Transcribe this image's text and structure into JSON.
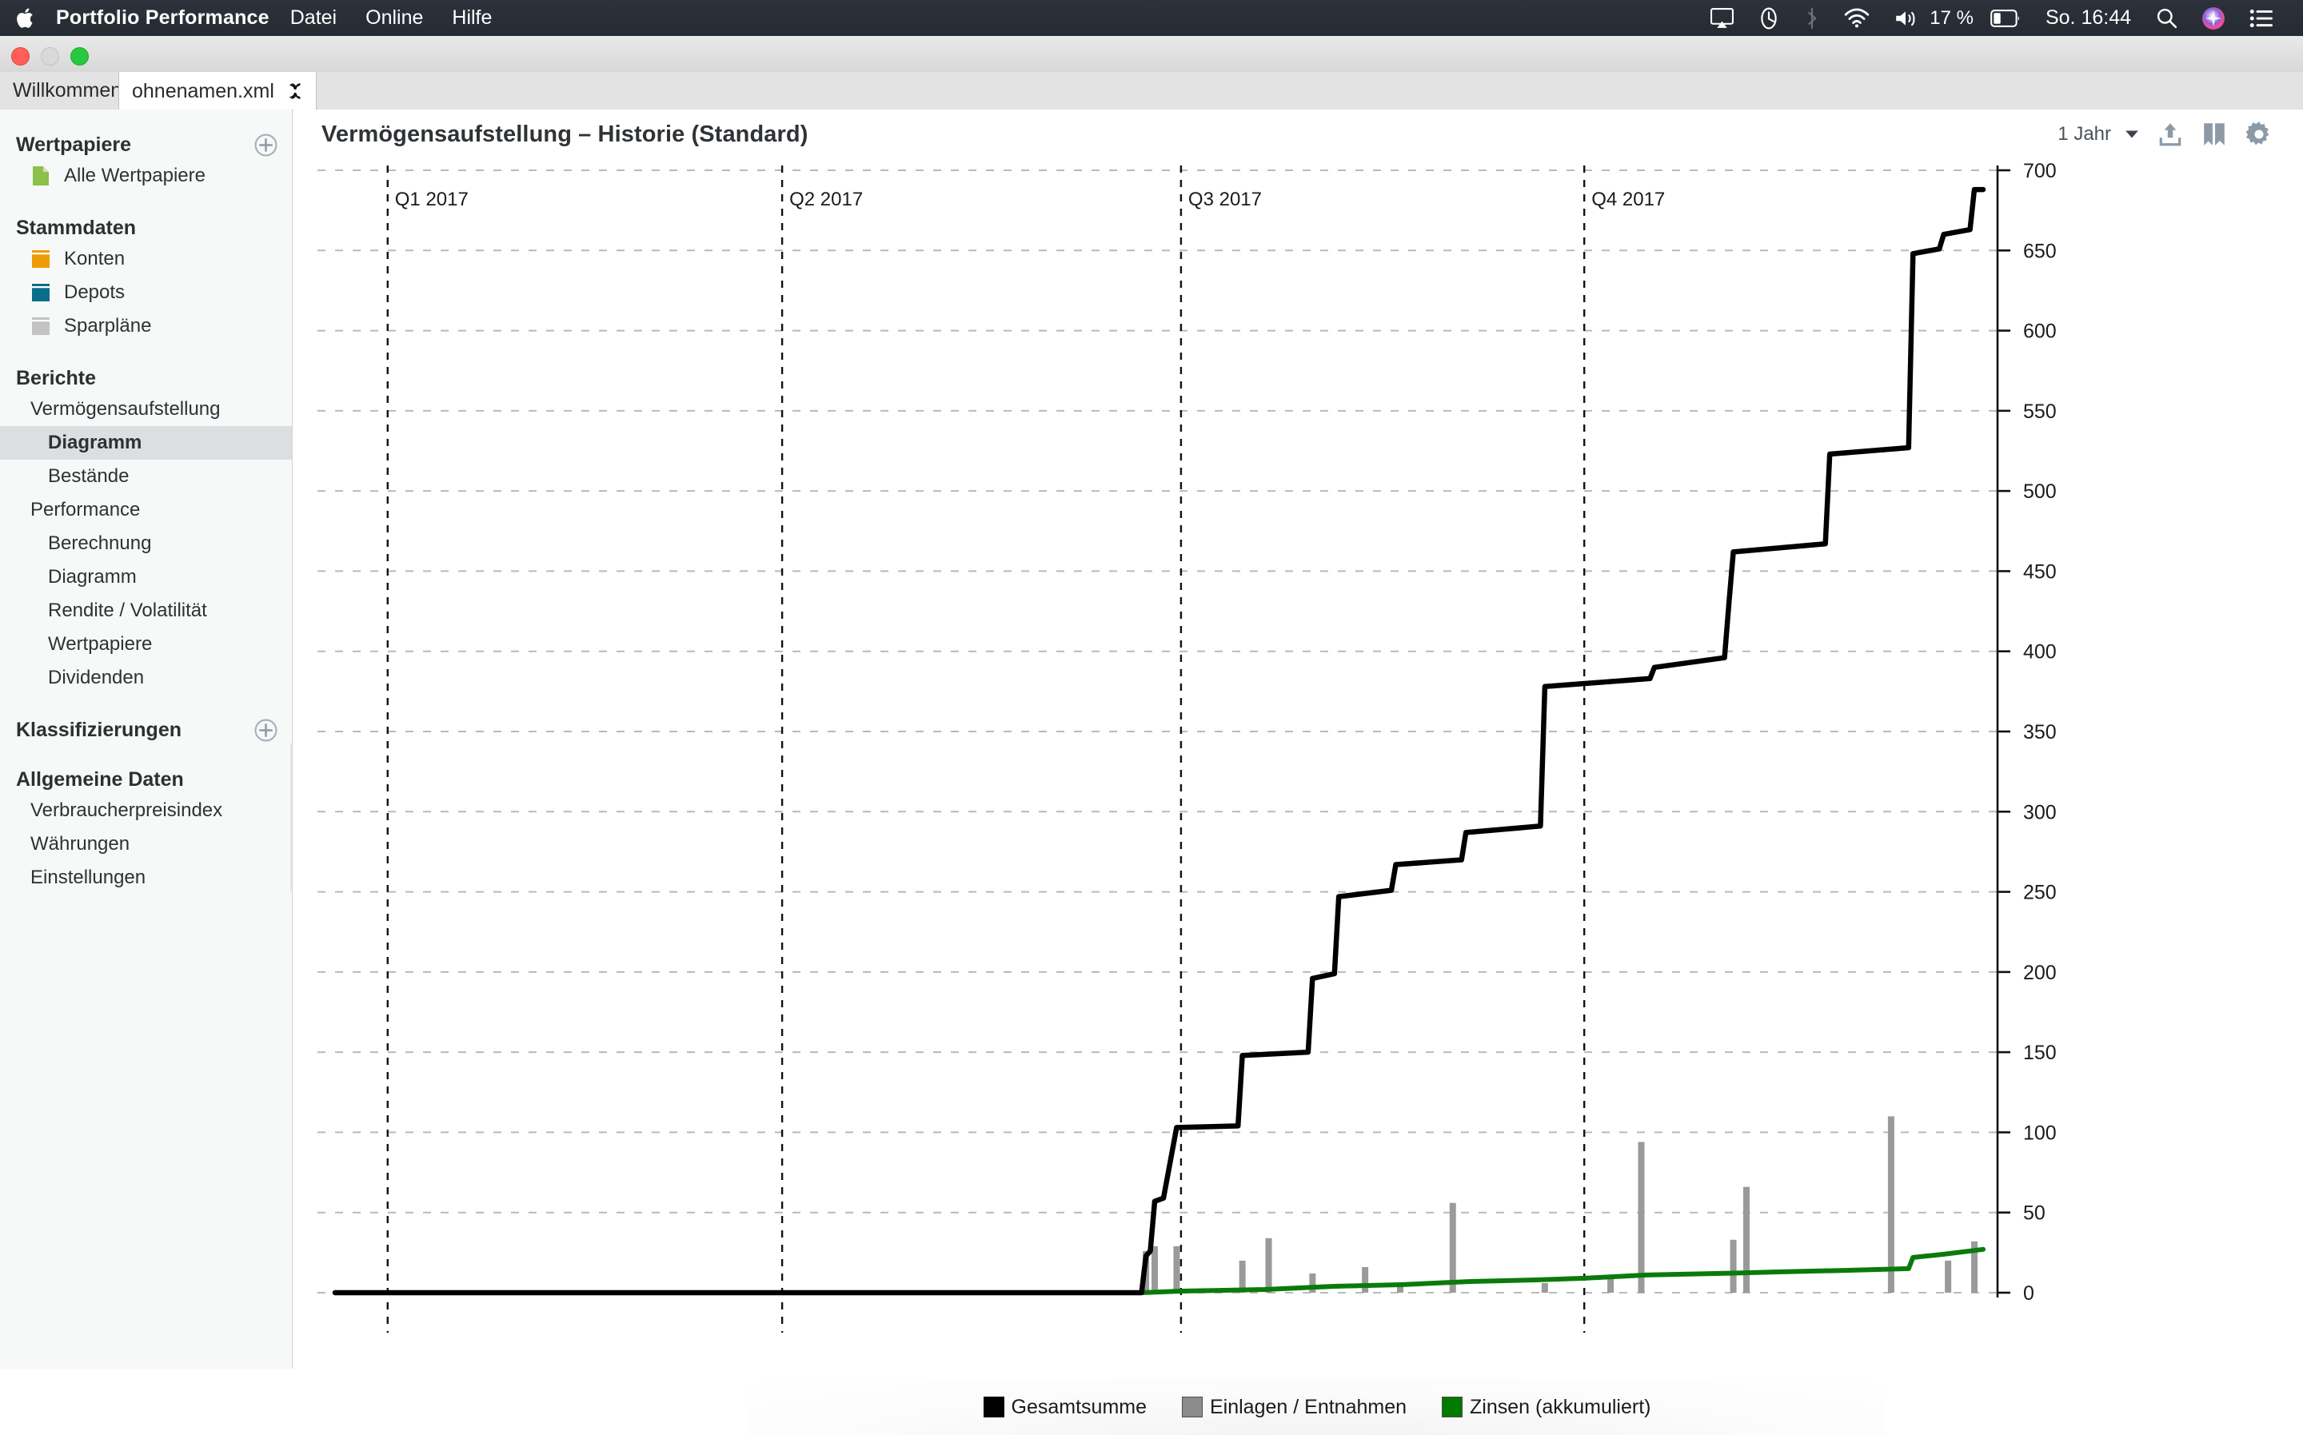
{
  "menubar": {
    "app_name": "Portfolio Performance",
    "menus": [
      "Datei",
      "Online",
      "Hilfe"
    ],
    "status": {
      "battery_percent": "17 %",
      "clock": "So. 16:44",
      "icons": [
        "airplay-icon",
        "time-machine-icon",
        "bluetooth-icon",
        "wifi-icon",
        "volume-icon",
        "battery-icon",
        "spotlight-search-icon",
        "siri-icon",
        "control-center-icon"
      ]
    }
  },
  "window": {
    "traffic_lights": [
      "close-button",
      "minimize-button",
      "zoom-button"
    ],
    "tabs": [
      {
        "label": "Willkommen",
        "active": false,
        "closable": false
      },
      {
        "label": "ohnenamen.xml",
        "active": true,
        "closable": true
      }
    ]
  },
  "sidebar": {
    "sections": [
      {
        "title": "Wertpapiere",
        "has_add": true,
        "items": [
          {
            "label": "Alle Wertpapiere",
            "icon": "document-icon",
            "color": "#8cc04a",
            "level": 1,
            "selected": false
          }
        ]
      },
      {
        "title": "Stammdaten",
        "has_add": false,
        "items": [
          {
            "label": "Konten",
            "icon": "book-icon",
            "color": "#ef9a08",
            "level": 1,
            "selected": false
          },
          {
            "label": "Depots",
            "icon": "book-icon",
            "color": "#0a6e8a",
            "level": 1,
            "selected": false
          },
          {
            "label": "Sparpläne",
            "icon": "book-icon",
            "color": "#c3c3c3",
            "level": 1,
            "selected": false
          }
        ]
      },
      {
        "title": "Berichte",
        "has_add": false,
        "items": [
          {
            "label": "Vermögensaufstellung",
            "icon": null,
            "color": null,
            "level": 1,
            "selected": false
          },
          {
            "label": "Diagramm",
            "icon": null,
            "color": null,
            "level": 2,
            "selected": true
          },
          {
            "label": "Bestände",
            "icon": null,
            "color": null,
            "level": 2,
            "selected": false
          },
          {
            "label": "Performance",
            "icon": null,
            "color": null,
            "level": 1,
            "selected": false
          },
          {
            "label": "Berechnung",
            "icon": null,
            "color": null,
            "level": 2,
            "selected": false
          },
          {
            "label": "Diagramm",
            "icon": null,
            "color": null,
            "level": 2,
            "selected": false
          },
          {
            "label": "Rendite / Volatilität",
            "icon": null,
            "color": null,
            "level": 2,
            "selected": false
          },
          {
            "label": "Wertpapiere",
            "icon": null,
            "color": null,
            "level": 2,
            "selected": false
          },
          {
            "label": "Dividenden",
            "icon": null,
            "color": null,
            "level": 2,
            "selected": false
          }
        ]
      },
      {
        "title": "Klassifizierungen",
        "has_add": true,
        "items": []
      },
      {
        "title": "Allgemeine Daten",
        "has_add": false,
        "items": [
          {
            "label": "Verbraucherpreisindex",
            "icon": null,
            "color": null,
            "level": 1,
            "selected": false
          },
          {
            "label": "Währungen",
            "icon": null,
            "color": null,
            "level": 1,
            "selected": false
          },
          {
            "label": "Einstellungen",
            "icon": null,
            "color": null,
            "level": 1,
            "selected": false
          }
        ]
      }
    ]
  },
  "content": {
    "title": "Vermögensaufstellung – Historie (Standard)",
    "toolbar": {
      "period_label": "1 Jahr",
      "period_caret": "chevron-down-icon",
      "buttons": [
        "export-icon",
        "bookmark-icon",
        "gear-icon"
      ]
    }
  },
  "chart_data": {
    "type": "line",
    "title": "Vermögensaufstellung – Historie (Standard)",
    "xlabel": "",
    "ylabel": "",
    "ylim": [
      0,
      700
    ],
    "yticks": [
      0,
      50,
      100,
      150,
      200,
      250,
      300,
      350,
      400,
      450,
      500,
      550,
      600,
      650,
      700
    ],
    "grid": true,
    "legend_position": "bottom",
    "x_axis_type": "time",
    "x_range": [
      "2016-12-20",
      "2017-12-31"
    ],
    "quarter_markers": [
      {
        "label": "Q1 2017",
        "x": "2017-01-01"
      },
      {
        "label": "Q2 2017",
        "x": "2017-04-01"
      },
      {
        "label": "Q3 2017",
        "x": "2017-07-01"
      },
      {
        "label": "Q4 2017",
        "x": "2017-10-01"
      }
    ],
    "series": [
      {
        "name": "Gesamtsumme",
        "type": "line",
        "color": "#000000",
        "points": [
          {
            "x": "2016-12-20",
            "y": 0
          },
          {
            "x": "2017-06-22",
            "y": 0
          },
          {
            "x": "2017-06-23",
            "y": 23
          },
          {
            "x": "2017-06-24",
            "y": 26
          },
          {
            "x": "2017-06-25",
            "y": 57
          },
          {
            "x": "2017-06-27",
            "y": 59
          },
          {
            "x": "2017-06-30",
            "y": 103
          },
          {
            "x": "2017-07-14",
            "y": 104
          },
          {
            "x": "2017-07-15",
            "y": 148
          },
          {
            "x": "2017-07-30",
            "y": 150
          },
          {
            "x": "2017-07-31",
            "y": 196
          },
          {
            "x": "2017-08-05",
            "y": 199
          },
          {
            "x": "2017-08-06",
            "y": 247
          },
          {
            "x": "2017-08-18",
            "y": 251
          },
          {
            "x": "2017-08-19",
            "y": 267
          },
          {
            "x": "2017-09-03",
            "y": 270
          },
          {
            "x": "2017-09-04",
            "y": 287
          },
          {
            "x": "2017-09-21",
            "y": 291
          },
          {
            "x": "2017-09-22",
            "y": 378
          },
          {
            "x": "2017-10-16",
            "y": 383
          },
          {
            "x": "2017-10-17",
            "y": 390
          },
          {
            "x": "2017-11-02",
            "y": 396
          },
          {
            "x": "2017-11-03",
            "y": 430
          },
          {
            "x": "2017-11-04",
            "y": 462
          },
          {
            "x": "2017-11-25",
            "y": 467
          },
          {
            "x": "2017-11-26",
            "y": 523
          },
          {
            "x": "2017-12-14",
            "y": 527
          },
          {
            "x": "2017-12-15",
            "y": 648
          },
          {
            "x": "2017-12-21",
            "y": 651
          },
          {
            "x": "2017-12-22",
            "y": 660
          },
          {
            "x": "2017-12-28",
            "y": 663
          },
          {
            "x": "2017-12-29",
            "y": 688
          },
          {
            "x": "2017-12-31",
            "y": 688
          }
        ]
      },
      {
        "name": "Zinsen (akkumuliert)",
        "type": "line",
        "color": "#0b7a0b",
        "points": [
          {
            "x": "2016-12-20",
            "y": 0
          },
          {
            "x": "2017-06-22",
            "y": 0
          },
          {
            "x": "2017-07-01",
            "y": 1
          },
          {
            "x": "2017-07-20",
            "y": 2
          },
          {
            "x": "2017-08-05",
            "y": 4
          },
          {
            "x": "2017-08-20",
            "y": 5
          },
          {
            "x": "2017-09-05",
            "y": 7
          },
          {
            "x": "2017-09-20",
            "y": 8
          },
          {
            "x": "2017-10-01",
            "y": 9
          },
          {
            "x": "2017-10-15",
            "y": 11
          },
          {
            "x": "2017-11-01",
            "y": 12
          },
          {
            "x": "2017-11-15",
            "y": 13
          },
          {
            "x": "2017-12-01",
            "y": 14
          },
          {
            "x": "2017-12-14",
            "y": 15
          },
          {
            "x": "2017-12-15",
            "y": 22
          },
          {
            "x": "2017-12-22",
            "y": 24
          },
          {
            "x": "2017-12-31",
            "y": 27
          }
        ]
      },
      {
        "name": "Einlagen / Entnahmen",
        "type": "bar",
        "color": "#9a9a9a",
        "bars": [
          {
            "x": "2017-06-23",
            "y": 26
          },
          {
            "x": "2017-06-25",
            "y": 29
          },
          {
            "x": "2017-06-30",
            "y": 29
          },
          {
            "x": "2017-07-15",
            "y": 20
          },
          {
            "x": "2017-07-21",
            "y": 34
          },
          {
            "x": "2017-07-31",
            "y": 12
          },
          {
            "x": "2017-08-12",
            "y": 16
          },
          {
            "x": "2017-08-20",
            "y": 5
          },
          {
            "x": "2017-09-01",
            "y": 56
          },
          {
            "x": "2017-09-22",
            "y": 6
          },
          {
            "x": "2017-10-07",
            "y": 9
          },
          {
            "x": "2017-10-14",
            "y": 94
          },
          {
            "x": "2017-11-04",
            "y": 33
          },
          {
            "x": "2017-11-07",
            "y": 66
          },
          {
            "x": "2017-12-10",
            "y": 110
          },
          {
            "x": "2017-12-23",
            "y": 20
          },
          {
            "x": "2017-12-29",
            "y": 32
          }
        ]
      }
    ],
    "legend": [
      {
        "label": "Gesamtsumme",
        "color": "#000000"
      },
      {
        "label": "Einlagen / Entnahmen",
        "color": "#8c8c8c"
      },
      {
        "label": "Zinsen (akkumuliert)",
        "color": "#007a00"
      }
    ]
  }
}
